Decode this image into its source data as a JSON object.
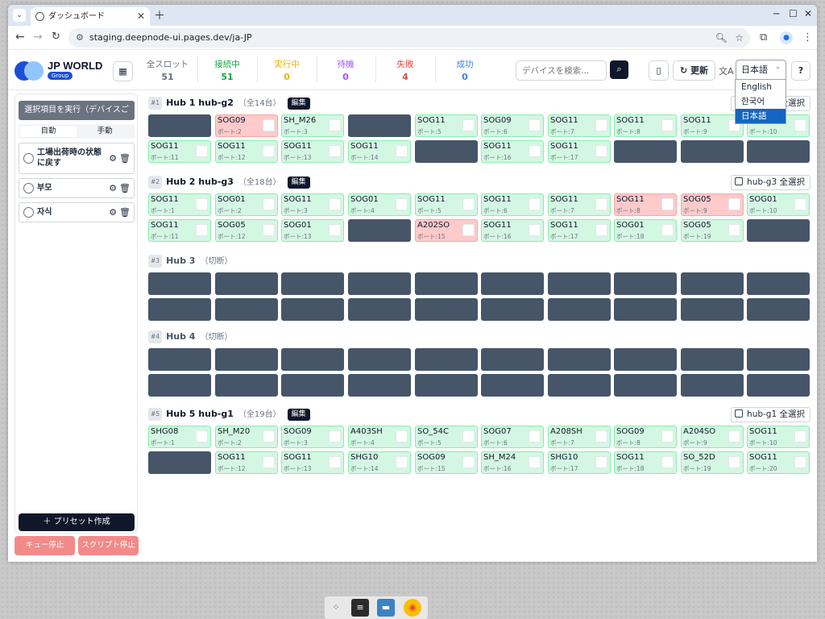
{
  "browser": {
    "tab_title": "ダッシュボード",
    "url": "staging.deepnode-ui.pages.dev/ja-JP"
  },
  "header": {
    "brand": "JP WORLD",
    "badge": "Group",
    "stats": [
      {
        "label": "全スロット",
        "value": "51",
        "color": "#6b7280"
      },
      {
        "label": "接続中",
        "value": "51",
        "color": "#16a34a"
      },
      {
        "label": "実行中",
        "value": "0",
        "color": "#eab308"
      },
      {
        "label": "待機",
        "value": "0",
        "color": "#a855f7"
      },
      {
        "label": "失敗",
        "value": "4",
        "color": "#ef4444"
      },
      {
        "label": "成功",
        "value": "0",
        "color": "#3b82f6"
      }
    ],
    "search_placeholder": "デバイスを検索...",
    "refresh_label": "更新",
    "language_selected": "日本語",
    "language_options": [
      "English",
      "한국어",
      "日本語"
    ]
  },
  "sidebar": {
    "run_label": "選択項目を実行（デバイスごと）",
    "mode_tabs": [
      "自動",
      "手動"
    ],
    "presets": [
      "工場出荷時の状態に戻す",
      "부모",
      "자식"
    ],
    "create_preset_label": "＋ プリセット作成",
    "queue_stop_label": "キュー停止",
    "script_stop_label": "スクリプト停止"
  },
  "hubs": [
    {
      "num": "#1",
      "name": "Hub 1 hub-g2",
      "count": "（全14台）",
      "edit": "編集",
      "select_all": "hub-g2 全選択",
      "connected": true,
      "cells": [
        null,
        {
          "name": "SOG09",
          "port": "ポート:2",
          "status": "fail"
        },
        {
          "name": "SH_M26",
          "port": "ポート:3",
          "status": "ok"
        },
        null,
        {
          "name": "SOG11",
          "port": "ポート:5",
          "status": "ok"
        },
        {
          "name": "SOG09",
          "port": "ポート:6",
          "status": "ok"
        },
        {
          "name": "SOG11",
          "port": "ポート:7",
          "status": "ok"
        },
        {
          "name": "SOG11",
          "port": "ポート:8",
          "status": "ok"
        },
        {
          "name": "SOG11",
          "port": "ポート:9",
          "status": "ok"
        },
        {
          "name": "",
          "port": "ポート:10",
          "status": "ok"
        },
        {
          "name": "SOG11",
          "port": "ポート:11",
          "status": "ok"
        },
        {
          "name": "SOG11",
          "port": "ポート:12",
          "status": "ok"
        },
        {
          "name": "SOG11",
          "port": "ポート:13",
          "status": "ok"
        },
        {
          "name": "SOG11",
          "port": "ポート:14",
          "status": "ok"
        },
        null,
        {
          "name": "SOG11",
          "port": "ポート:16",
          "status": "ok"
        },
        {
          "name": "SOG11",
          "port": "ポート:17",
          "status": "ok"
        },
        null,
        null,
        null
      ]
    },
    {
      "num": "#2",
      "name": "Hub 2 hub-g3",
      "count": "（全18台）",
      "edit": "編集",
      "select_all": "hub-g3 全選択",
      "connected": true,
      "cells": [
        {
          "name": "SOG11",
          "port": "ポート:1",
          "status": "ok"
        },
        {
          "name": "SOG01",
          "port": "ポート:2",
          "status": "ok"
        },
        {
          "name": "SOG11",
          "port": "ポート:3",
          "status": "ok"
        },
        {
          "name": "SOG01",
          "port": "ポート:4",
          "status": "ok"
        },
        {
          "name": "SOG11",
          "port": "ポート:5",
          "status": "ok"
        },
        {
          "name": "SOG11",
          "port": "ポート:6",
          "status": "ok"
        },
        {
          "name": "SOG11",
          "port": "ポート:7",
          "status": "ok"
        },
        {
          "name": "SOG11",
          "port": "ポート:8",
          "status": "fail"
        },
        {
          "name": "SOG05",
          "port": "ポート:9",
          "status": "fail"
        },
        {
          "name": "SOG01",
          "port": "ポート:10",
          "status": "ok"
        },
        {
          "name": "SOG11",
          "port": "ポート:11",
          "status": "ok"
        },
        {
          "name": "SOG05",
          "port": "ポート:12",
          "status": "ok"
        },
        {
          "name": "SOG01",
          "port": "ポート:13",
          "status": "ok"
        },
        null,
        {
          "name": "A202SO",
          "port": "ポート:15",
          "status": "fail"
        },
        {
          "name": "SOG11",
          "port": "ポート:16",
          "status": "ok"
        },
        {
          "name": "SOG11",
          "port": "ポート:17",
          "status": "ok"
        },
        {
          "name": "SOG01",
          "port": "ポート:18",
          "status": "ok"
        },
        {
          "name": "SOG05",
          "port": "ポート:19",
          "status": "ok"
        },
        null
      ]
    },
    {
      "num": "#3",
      "name": "Hub 3",
      "count": "（切断）",
      "connected": false,
      "cells": [
        null,
        null,
        null,
        null,
        null,
        null,
        null,
        null,
        null,
        null,
        null,
        null,
        null,
        null,
        null,
        null,
        null,
        null,
        null,
        null
      ]
    },
    {
      "num": "#4",
      "name": "Hub 4",
      "count": "（切断）",
      "connected": false,
      "cells": [
        null,
        null,
        null,
        null,
        null,
        null,
        null,
        null,
        null,
        null,
        null,
        null,
        null,
        null,
        null,
        null,
        null,
        null,
        null,
        null
      ]
    },
    {
      "num": "#5",
      "name": "Hub 5 hub-g1",
      "count": "（全19台）",
      "edit": "編集",
      "select_all": "hub-g1 全選択",
      "connected": true,
      "cells": [
        {
          "name": "SHG08",
          "port": "ポート:1",
          "status": "ok"
        },
        {
          "name": "SH_M20",
          "port": "ポート:2",
          "status": "ok"
        },
        {
          "name": "SOG09",
          "port": "ポート:3",
          "status": "ok"
        },
        {
          "name": "A403SH",
          "port": "ポート:4",
          "status": "ok"
        },
        {
          "name": "SO_54C",
          "port": "ポート:5",
          "status": "ok"
        },
        {
          "name": "SOG07",
          "port": "ポート:6",
          "status": "ok"
        },
        {
          "name": "A208SH",
          "port": "ポート:7",
          "status": "ok"
        },
        {
          "name": "SOG09",
          "port": "ポート:8",
          "status": "ok"
        },
        {
          "name": "A204SO",
          "port": "ポート:9",
          "status": "ok"
        },
        {
          "name": "SOG11",
          "port": "ポート:10",
          "status": "ok"
        },
        null,
        {
          "name": "SOG11",
          "port": "ポート:12",
          "status": "ok"
        },
        {
          "name": "SOG11",
          "port": "ポート:13",
          "status": "ok"
        },
        {
          "name": "SHG10",
          "port": "ポート:14",
          "status": "ok"
        },
        {
          "name": "SOG09",
          "port": "ポート:15",
          "status": "ok"
        },
        {
          "name": "SH_M24",
          "port": "ポート:16",
          "status": "ok"
        },
        {
          "name": "SHG10",
          "port": "ポート:17",
          "status": "ok"
        },
        {
          "name": "SOG11",
          "port": "ポート:18",
          "status": "ok"
        },
        {
          "name": "SO_52D",
          "port": "ポート:19",
          "status": "ok"
        },
        {
          "name": "SOG11",
          "port": "ポート:20",
          "status": "ok"
        }
      ]
    }
  ]
}
